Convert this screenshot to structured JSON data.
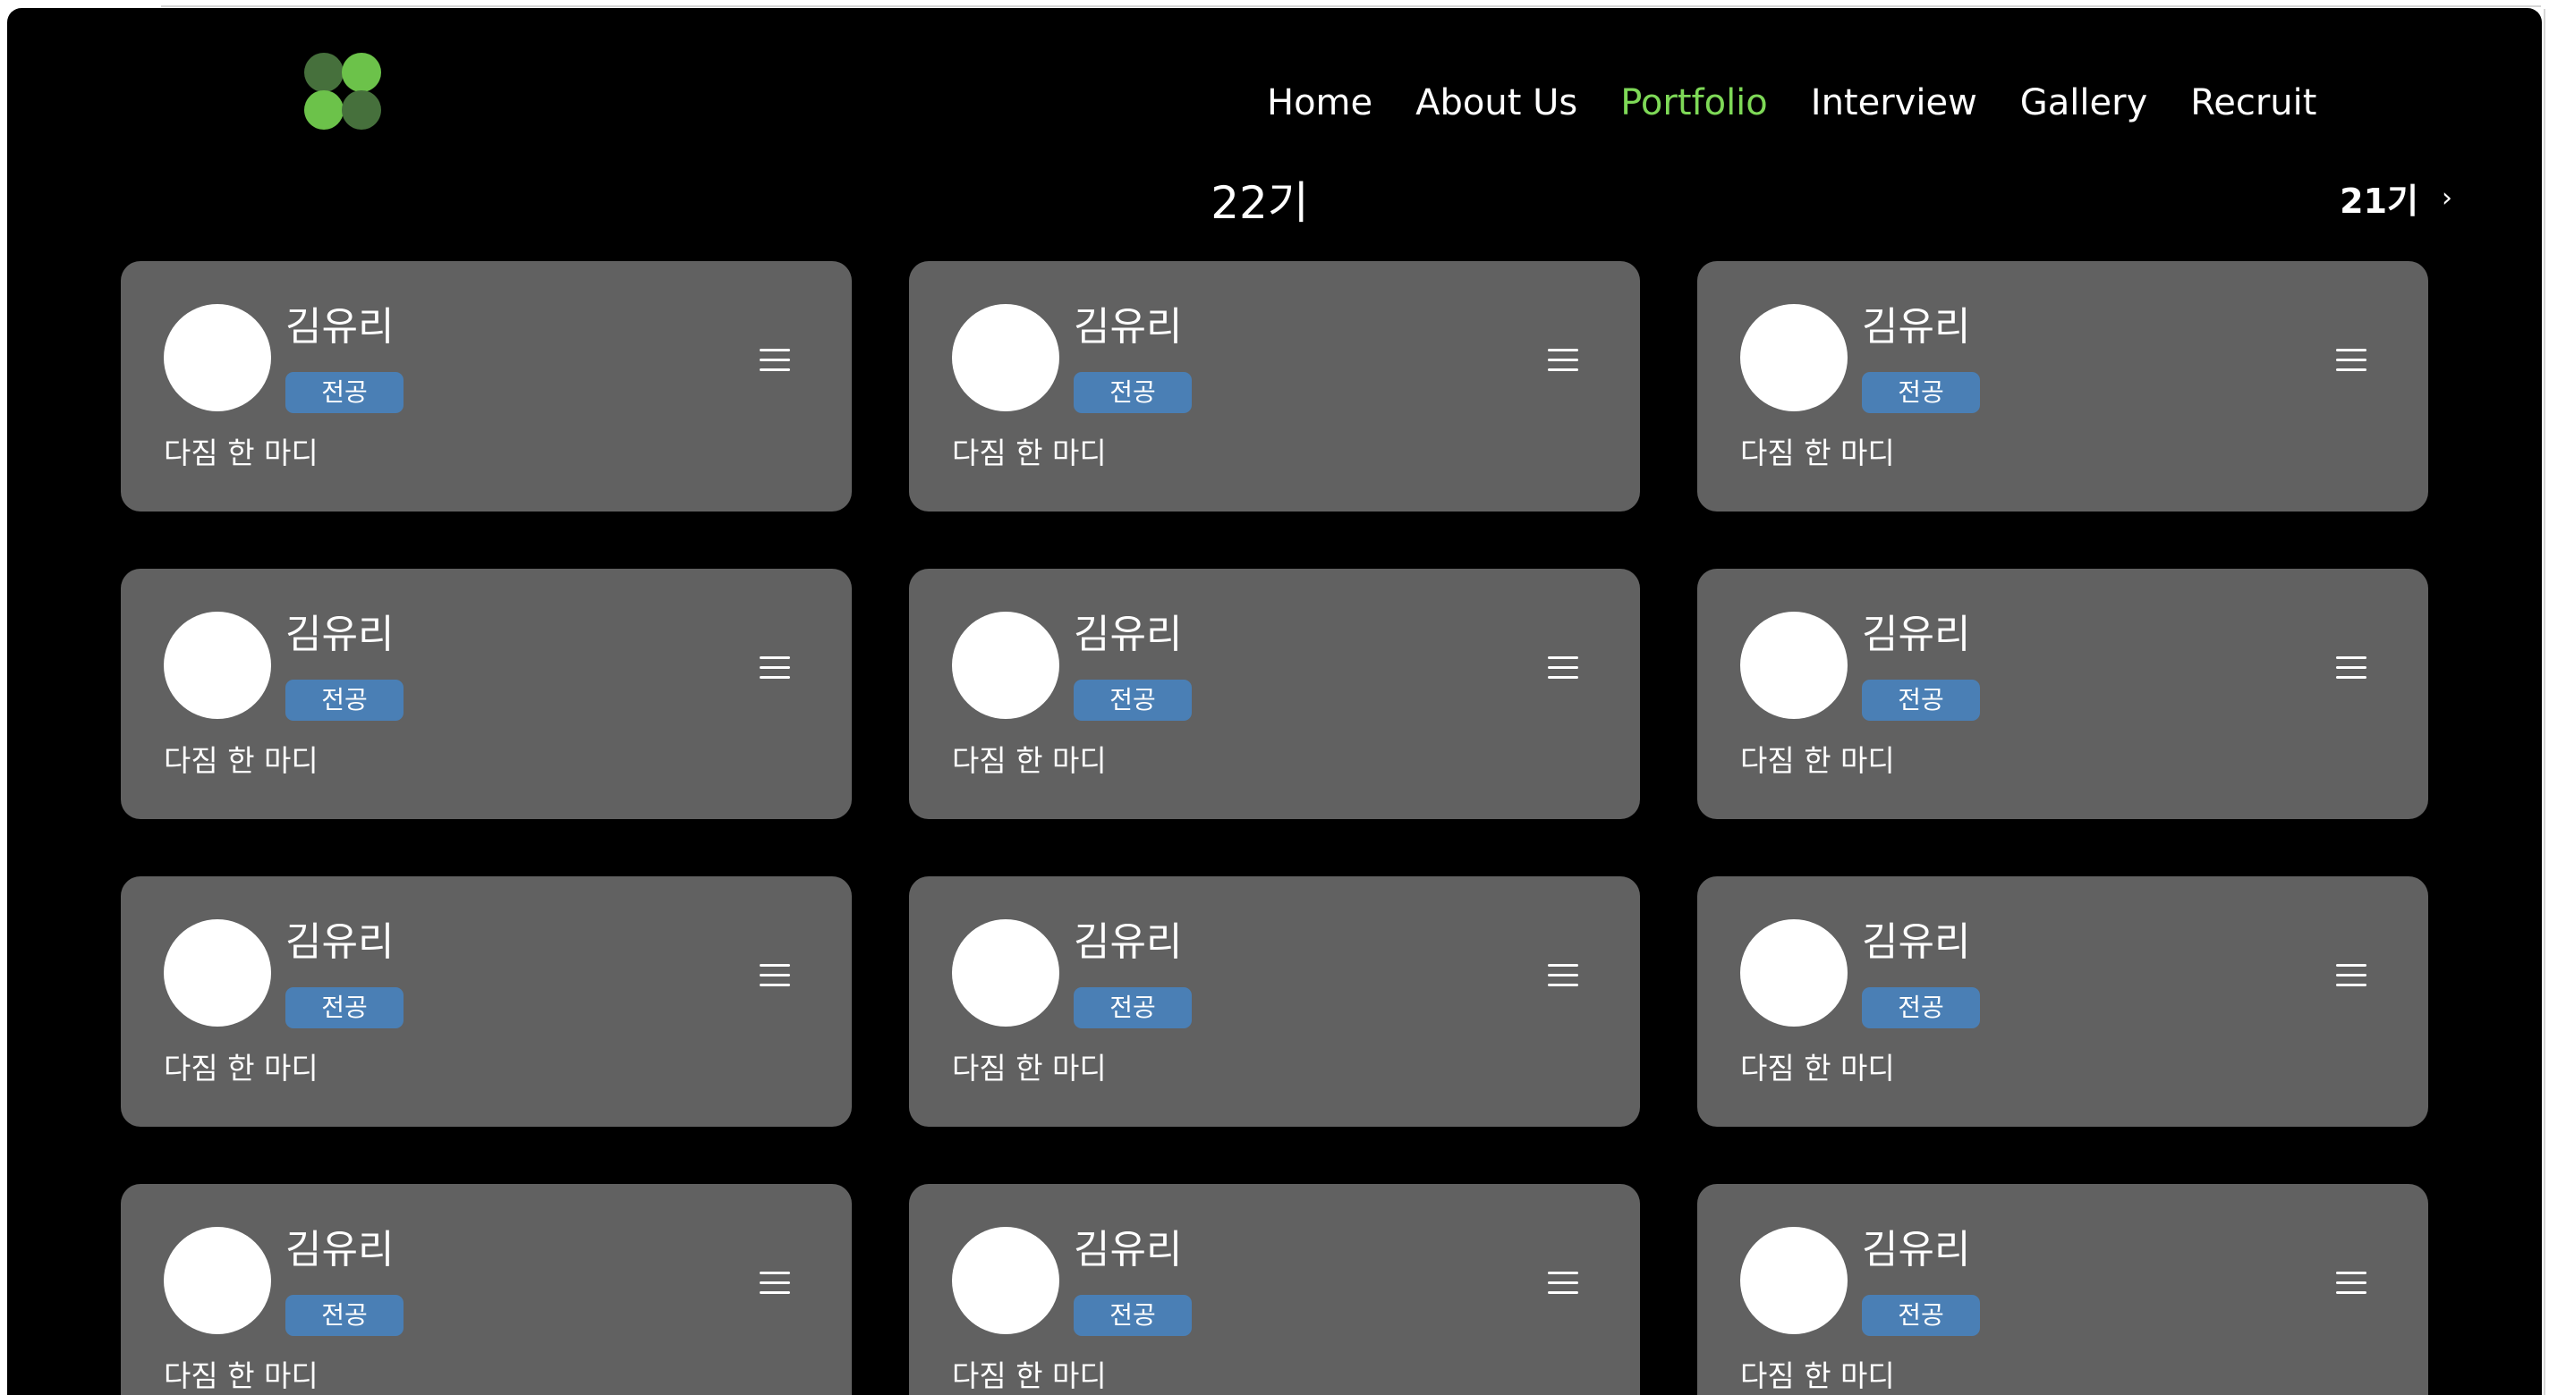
{
  "nav": {
    "items": [
      {
        "label": "Home",
        "active": false
      },
      {
        "label": "About Us",
        "active": false
      },
      {
        "label": "Portfolio",
        "active": true
      },
      {
        "label": "Interview",
        "active": false
      },
      {
        "label": "Gallery",
        "active": false
      },
      {
        "label": "Recruit",
        "active": false
      }
    ],
    "active_color": "#7ed957"
  },
  "logo": {
    "icon": "clover-logo-icon",
    "colors": [
      "#46703c",
      "#6cc24a"
    ]
  },
  "cohort": {
    "current": "22기",
    "next_label": "21기",
    "next_icon": "chevron-right-icon"
  },
  "colors": {
    "background": "#000000",
    "card": "#616161",
    "badge": "#4a7fb5"
  },
  "members": [
    {
      "name": "김유리",
      "major": "전공",
      "motto": "다짐 한 마디"
    },
    {
      "name": "김유리",
      "major": "전공",
      "motto": "다짐 한 마디"
    },
    {
      "name": "김유리",
      "major": "전공",
      "motto": "다짐 한 마디"
    },
    {
      "name": "김유리",
      "major": "전공",
      "motto": "다짐 한 마디"
    },
    {
      "name": "김유리",
      "major": "전공",
      "motto": "다짐 한 마디"
    },
    {
      "name": "김유리",
      "major": "전공",
      "motto": "다짐 한 마디"
    },
    {
      "name": "김유리",
      "major": "전공",
      "motto": "다짐 한 마디"
    },
    {
      "name": "김유리",
      "major": "전공",
      "motto": "다짐 한 마디"
    },
    {
      "name": "김유리",
      "major": "전공",
      "motto": "다짐 한 마디"
    },
    {
      "name": "김유리",
      "major": "전공",
      "motto": "다짐 한 마디"
    },
    {
      "name": "김유리",
      "major": "전공",
      "motto": "다짐 한 마디"
    },
    {
      "name": "김유리",
      "major": "전공",
      "motto": "다짐 한 마디"
    }
  ]
}
